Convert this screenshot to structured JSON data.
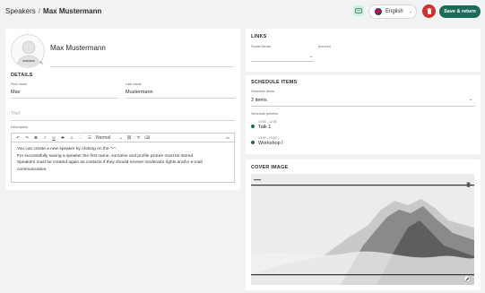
{
  "header": {
    "breadcrumb_root": "Speakers",
    "breadcrumb_sep": "/",
    "breadcrumb_current": "Max Mustermann",
    "language": "English",
    "save_label": "Save & return"
  },
  "profile": {
    "name": "Max Mustermann"
  },
  "details": {
    "title": "DETAILS",
    "first_name_label": "First name",
    "first_name_value": "Max",
    "last_name_label": "Last name",
    "last_name_value": "Mustermann",
    "title_placeholder": "Titel",
    "description_label": "Description",
    "editor_format": "Normal",
    "description_lines": [
      "You can create a new speaker by clicking on the \"+\".",
      "For successfully saving a speaker the first name, surname and profile picture must be stored.",
      "Speakers must be created again as contacts if they should receive moderator rights and/or e-mail communication."
    ]
  },
  "links": {
    "title": "LINKS",
    "social_media_label": "Social Media",
    "account_label": "Account"
  },
  "schedule": {
    "title": "SCHEDULE ITEMS",
    "items_label": "Schedule items",
    "items_value": "2 items",
    "preview_label": "Schedule preview",
    "items": [
      {
        "time": "10:00 - 12:00",
        "title": "Talk 1"
      },
      {
        "time": "13:00 - 15:00",
        "title": "Workshop I"
      }
    ]
  },
  "cover": {
    "title": "COVER IMAGE"
  },
  "colors": {
    "accent": "#1b6b59",
    "danger": "#d32f2f"
  }
}
